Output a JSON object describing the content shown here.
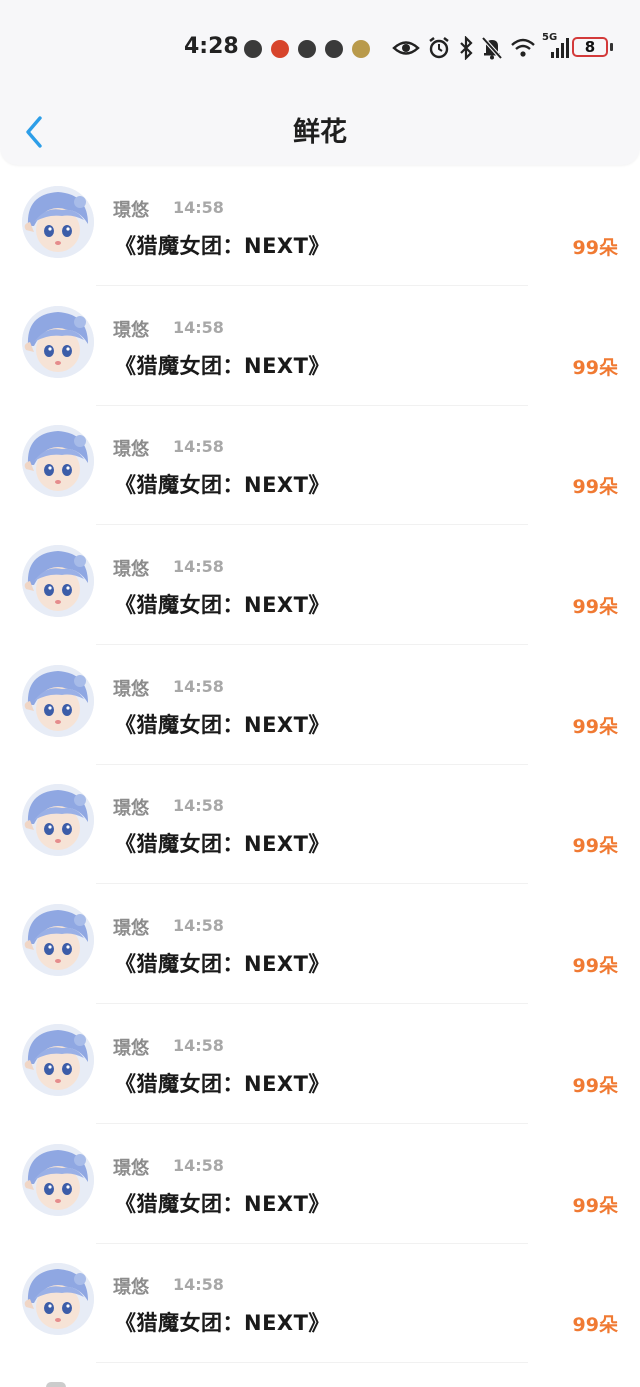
{
  "status_bar": {
    "time": "4:28",
    "battery": "8",
    "network": "5G",
    "icons": [
      "eye-icon",
      "alarm-icon",
      "bluetooth-icon",
      "bell-mute-icon",
      "wifi-icon",
      "signal-icon"
    ]
  },
  "header": {
    "title": "鲜花",
    "back_icon": "chevron-left-icon"
  },
  "colors": {
    "accent_back": "#2d9ee8",
    "count": "#f07a33",
    "battery_border": "#d33a3a"
  },
  "list": [
    {
      "name": "璟悠",
      "time": "14:58",
      "gift": "《猎魔女团：NEXT》",
      "count": "99朵"
    },
    {
      "name": "璟悠",
      "time": "14:58",
      "gift": "《猎魔女团：NEXT》",
      "count": "99朵"
    },
    {
      "name": "璟悠",
      "time": "14:58",
      "gift": "《猎魔女团：NEXT》",
      "count": "99朵"
    },
    {
      "name": "璟悠",
      "time": "14:58",
      "gift": "《猎魔女团：NEXT》",
      "count": "99朵"
    },
    {
      "name": "璟悠",
      "time": "14:58",
      "gift": "《猎魔女团：NEXT》",
      "count": "99朵"
    },
    {
      "name": "璟悠",
      "time": "14:58",
      "gift": "《猎魔女团：NEXT》",
      "count": "99朵"
    },
    {
      "name": "璟悠",
      "time": "14:58",
      "gift": "《猎魔女团：NEXT》",
      "count": "99朵"
    },
    {
      "name": "璟悠",
      "time": "14:58",
      "gift": "《猎魔女团：NEXT》",
      "count": "99朵"
    },
    {
      "name": "璟悠",
      "time": "14:58",
      "gift": "《猎魔女团：NEXT》",
      "count": "99朵"
    },
    {
      "name": "璟悠",
      "time": "14:58",
      "gift": "《猎魔女团：NEXT》",
      "count": "99朵"
    }
  ]
}
